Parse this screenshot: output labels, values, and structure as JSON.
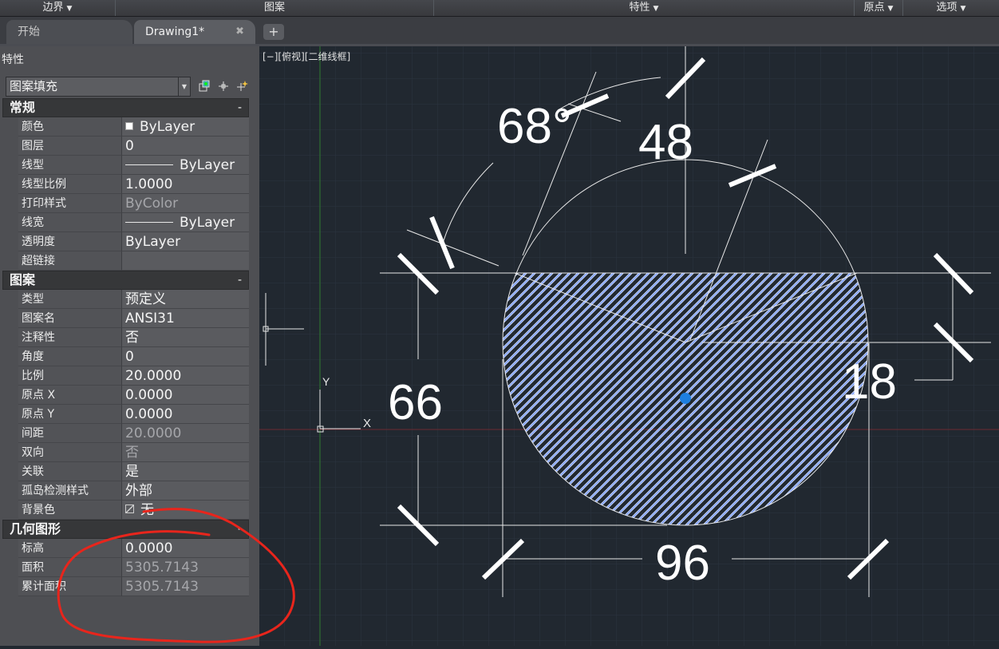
{
  "ribbon": {
    "boundary": "边界",
    "pattern": "图案",
    "properties": "特性",
    "origin": "原点",
    "options": "选项"
  },
  "tabs": {
    "start": "开始",
    "drawing": "Drawing1*",
    "close": "✖",
    "add": "+"
  },
  "palette": {
    "title": "特性",
    "object_type": "图案填充",
    "sections": {
      "general": {
        "label": "常规",
        "collapse": "-",
        "rows": [
          {
            "key": "颜色",
            "value": "ByLayer"
          },
          {
            "key": "图层",
            "value": "0"
          },
          {
            "key": "线型",
            "value": "ByLayer"
          },
          {
            "key": "线型比例",
            "value": "1.0000"
          },
          {
            "key": "打印样式",
            "value": "ByColor"
          },
          {
            "key": "线宽",
            "value": "ByLayer"
          },
          {
            "key": "透明度",
            "value": "ByLayer"
          },
          {
            "key": "超链接",
            "value": ""
          }
        ]
      },
      "pattern": {
        "label": "图案",
        "collapse": "-",
        "rows": [
          {
            "key": "类型",
            "value": "预定义"
          },
          {
            "key": "图案名",
            "value": "ANSI31"
          },
          {
            "key": "注释性",
            "value": "否"
          },
          {
            "key": "角度",
            "value": "0"
          },
          {
            "key": "比例",
            "value": "20.0000"
          },
          {
            "key": "原点 X",
            "value": "0.0000"
          },
          {
            "key": "原点 Y",
            "value": "0.0000"
          },
          {
            "key": "间距",
            "value": "20.0000"
          },
          {
            "key": "双向",
            "value": "否"
          },
          {
            "key": "关联",
            "value": "是"
          },
          {
            "key": "孤岛检测样式",
            "value": "外部"
          },
          {
            "key": "背景色",
            "value": "无"
          }
        ]
      },
      "geometry": {
        "label": "几何图形",
        "collapse": "-",
        "rows": [
          {
            "key": "标高",
            "value": "0.0000"
          },
          {
            "key": "面积",
            "value": "5305.7143"
          },
          {
            "key": "累计面积",
            "value": "5305.7143"
          }
        ]
      }
    }
  },
  "viewport": {
    "label": "[−][俯视][二维线框]",
    "ucs_y": "Y",
    "ucs_x": "X"
  },
  "drawing": {
    "dim_angle": "68°",
    "dim_top": "48",
    "dim_height": "66",
    "dim_right": "18",
    "dim_width": "96"
  },
  "colors": {
    "background": "#212830",
    "grid": "#2e3642",
    "hatch": "#8fb0ff",
    "annotation": "#e8251c",
    "grip": "#1e7fe0"
  }
}
